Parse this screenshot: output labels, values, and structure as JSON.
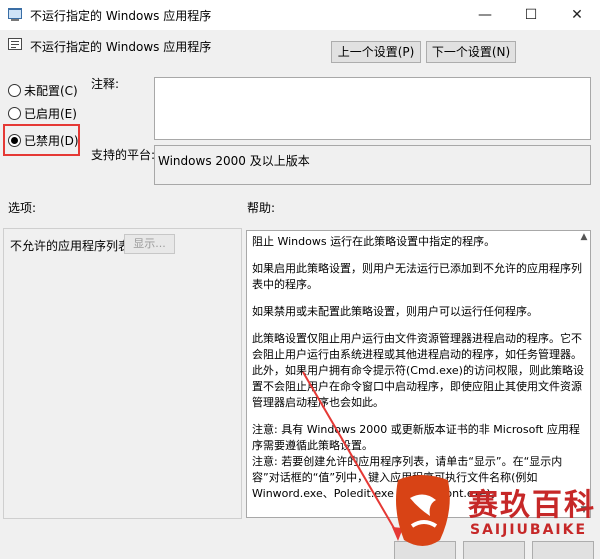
{
  "window": {
    "title": "不运行指定的 Windows 应用程序",
    "minimize_glyph": "—",
    "maximize_glyph": "☐",
    "close_glyph": "✕"
  },
  "header": {
    "setting_title": "不运行指定的 Windows 应用程序",
    "prev_button": "上一个设置(P)",
    "next_button": "下一个设置(N)"
  },
  "state_options": [
    {
      "label": "未配置(C)",
      "selected": false
    },
    {
      "label": "已启用(E)",
      "selected": false
    },
    {
      "label": "已禁用(D)",
      "selected": true
    }
  ],
  "comment": {
    "label": "注释:",
    "value": ""
  },
  "platform": {
    "label": "支持的平台:",
    "value": "Windows 2000 及以上版本"
  },
  "options": {
    "label": "选项:",
    "list_label": "不允许的应用程序列表",
    "show_button": "显示..."
  },
  "help": {
    "label": "帮助:",
    "paragraphs": [
      "阻止 Windows 运行在此策略设置中指定的程序。",
      "如果启用此策略设置，则用户无法运行已添加到不允许的应用程序列表中的程序。",
      "如果禁用或未配置此策略设置，则用户可以运行任何程序。",
      "此策略设置仅阻止用户运行由文件资源管理器进程启动的程序。它不会阻止用户运行由系统进程或其他进程启动的程序，如任务管理器。 此外，如果用户拥有命令提示符(Cmd.exe)的访问权限，则此策略设置不会阻止用户在命令窗口中启动程序，即使应阻止其使用文件资源管理器启动程序也会如此。",
      "注意: 具有 Windows 2000 或更新版本证书的非 Microsoft 应用程序需要遵循此策略设置。",
      "注意: 若要创建允许的应用程序列表，请单击“显示”。在“显示内容”对话框的“值”列中，键入应用程序可执行文件名称(例如 Winword.exe、Poledit.exe 和 Powerpnt.exe)。"
    ]
  },
  "watermark": {
    "brand": "赛玖百科",
    "pinyin": "SAIJIUBAIKE"
  },
  "colors": {
    "highlight": "#e53935",
    "watermark": "#c62828"
  }
}
